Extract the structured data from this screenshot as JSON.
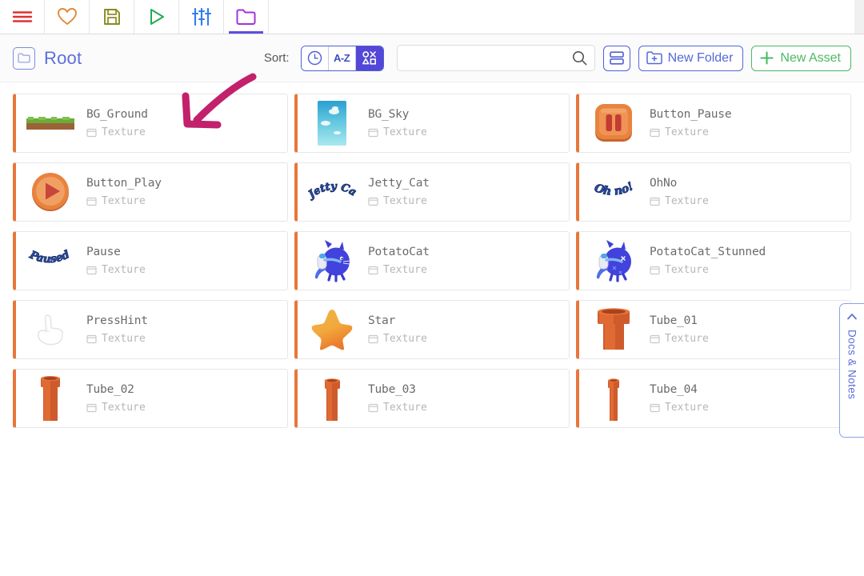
{
  "toolbar": {
    "buttons": [
      {
        "name": "menu-icon",
        "label": "Menu"
      },
      {
        "name": "favorite-icon",
        "label": "Favorites"
      },
      {
        "name": "save-icon",
        "label": "Save"
      },
      {
        "name": "play-icon",
        "label": "Play"
      },
      {
        "name": "settings-sliders-icon",
        "label": "Settings"
      },
      {
        "name": "assets-folder-icon",
        "label": "Assets"
      }
    ],
    "active_index": 5
  },
  "header": {
    "breadcrumb": "Root",
    "breadcrumb_icon": "folder-icon",
    "sort_label": "Sort:",
    "sort_options": [
      {
        "name": "sort-by-recent",
        "icon": "clock-icon",
        "label": "",
        "active": false
      },
      {
        "name": "sort-alphabetical",
        "icon": "a-z-icon",
        "label": "A-Z",
        "active": false
      },
      {
        "name": "sort-by-type",
        "icon": "shapes-icon",
        "label": "",
        "active": true
      }
    ],
    "search": {
      "value": "",
      "placeholder": ""
    },
    "view_toggle": "list-view-icon",
    "new_folder_label": "New Folder",
    "new_asset_label": "New Asset"
  },
  "side_panel": {
    "label": "Docs & Notes",
    "collapse_icon": "chevron-left-icon"
  },
  "assets": {
    "type_label": "Texture",
    "items": [
      {
        "name": "BG_Ground",
        "type": "Texture",
        "thumb": "bg-ground"
      },
      {
        "name": "BG_Sky",
        "type": "Texture",
        "thumb": "bg-sky"
      },
      {
        "name": "Button_Pause",
        "type": "Texture",
        "thumb": "button-pause"
      },
      {
        "name": "Button_Play",
        "type": "Texture",
        "thumb": "button-play"
      },
      {
        "name": "Jetty_Cat",
        "type": "Texture",
        "thumb": "jetty-cat-logo"
      },
      {
        "name": "OhNo",
        "type": "Texture",
        "thumb": "ohno-logo"
      },
      {
        "name": "Pause",
        "type": "Texture",
        "thumb": "paused-logo"
      },
      {
        "name": "PotatoCat",
        "type": "Texture",
        "thumb": "potato-cat"
      },
      {
        "name": "PotatoCat_Stunned",
        "type": "Texture",
        "thumb": "potato-cat-stunned"
      },
      {
        "name": "PressHint",
        "type": "Texture",
        "thumb": "press-hint"
      },
      {
        "name": "Star",
        "type": "Texture",
        "thumb": "star"
      },
      {
        "name": "Tube_01",
        "type": "Texture",
        "thumb": "tube-01"
      },
      {
        "name": "Tube_02",
        "type": "Texture",
        "thumb": "tube-02"
      },
      {
        "name": "Tube_03",
        "type": "Texture",
        "thumb": "tube-03"
      },
      {
        "name": "Tube_04",
        "type": "Texture",
        "thumb": "tube-04"
      }
    ]
  },
  "logo_text": {
    "jetty_cat": "Jetty Cat",
    "ohno": "Oh no!",
    "paused": "Paused"
  },
  "annotation": {
    "kind": "arrow",
    "color": "#c2216b"
  },
  "colors": {
    "accent_purple": "#5247d6",
    "link_blue": "#5c6fd8",
    "green": "#4cb963",
    "card_accent": "#e8763b",
    "annotation": "#c2216b"
  }
}
